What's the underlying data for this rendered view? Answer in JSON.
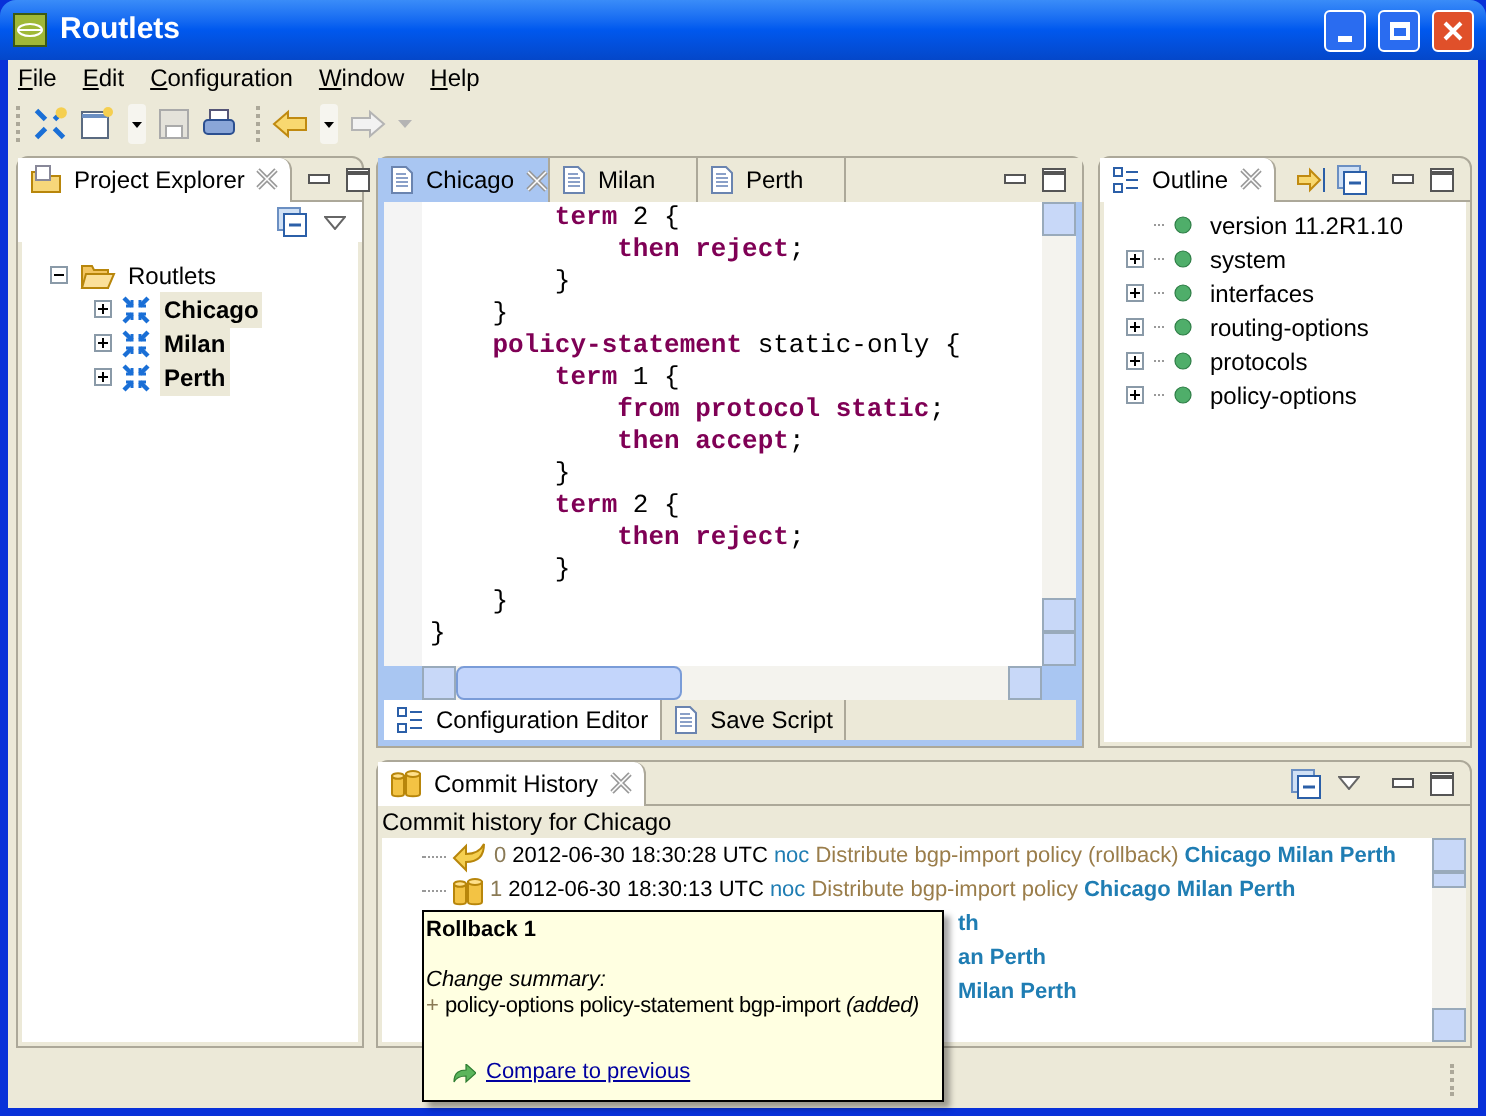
{
  "window": {
    "title": "Routlets"
  },
  "menu": [
    "File",
    "Edit",
    "Configuration",
    "Window",
    "Help"
  ],
  "project_explorer": {
    "tab": "Project Explorer",
    "root": {
      "label": "Routlets",
      "expanded": true,
      "children": [
        {
          "label": "Chicago",
          "expanded": false,
          "open": true
        },
        {
          "label": "Milan",
          "expanded": false,
          "open": true
        },
        {
          "label": "Perth",
          "expanded": false,
          "open": true
        }
      ]
    }
  },
  "editor": {
    "tabs": [
      {
        "label": "Chicago",
        "selected": true
      },
      {
        "label": "Milan",
        "selected": false
      },
      {
        "label": "Perth",
        "selected": false
      }
    ],
    "lines": [
      {
        "tokens": [
          {
            "kind": "keyword",
            "text": "        term"
          },
          {
            "kind": "plain",
            "text": " 2 {"
          }
        ]
      },
      {
        "tokens": [
          {
            "kind": "keyword",
            "text": "            then reject"
          },
          {
            "kind": "plain",
            "text": ";"
          }
        ]
      },
      {
        "tokens": [
          {
            "kind": "plain",
            "text": "        }"
          }
        ]
      },
      {
        "tokens": [
          {
            "kind": "plain",
            "text": "    }"
          }
        ]
      },
      {
        "tokens": [
          {
            "kind": "keyword",
            "text": "    policy-statement"
          },
          {
            "kind": "plain",
            "text": " static-only {"
          }
        ]
      },
      {
        "tokens": [
          {
            "kind": "keyword",
            "text": "        term"
          },
          {
            "kind": "plain",
            "text": " 1 {"
          }
        ]
      },
      {
        "tokens": [
          {
            "kind": "keyword",
            "text": "            from protocol static"
          },
          {
            "kind": "plain",
            "text": ";"
          }
        ]
      },
      {
        "tokens": [
          {
            "kind": "keyword",
            "text": "            then accept"
          },
          {
            "kind": "plain",
            "text": ";"
          }
        ]
      },
      {
        "tokens": [
          {
            "kind": "plain",
            "text": "        }"
          }
        ]
      },
      {
        "tokens": [
          {
            "kind": "keyword",
            "text": "        term"
          },
          {
            "kind": "plain",
            "text": " 2 {"
          }
        ]
      },
      {
        "tokens": [
          {
            "kind": "keyword",
            "text": "            then reject"
          },
          {
            "kind": "plain",
            "text": ";"
          }
        ]
      },
      {
        "tokens": [
          {
            "kind": "plain",
            "text": "        }"
          }
        ]
      },
      {
        "tokens": [
          {
            "kind": "plain",
            "text": "    }"
          }
        ]
      },
      {
        "tokens": [
          {
            "kind": "plain",
            "text": "}"
          }
        ]
      }
    ],
    "bottom_tabs": [
      {
        "label": "Configuration Editor",
        "selected": true
      },
      {
        "label": "Save Script",
        "selected": false
      }
    ]
  },
  "outline": {
    "tab": "Outline",
    "items": [
      {
        "label": "version 11.2R1.10",
        "kind": "leaf"
      },
      {
        "label": "system",
        "kind": "collapsed"
      },
      {
        "label": "interfaces",
        "kind": "collapsed"
      },
      {
        "label": "routing-options",
        "kind": "collapsed"
      },
      {
        "label": "protocols",
        "kind": "collapsed"
      },
      {
        "label": "policy-options",
        "kind": "collapsed"
      }
    ]
  },
  "commit_history": {
    "tab": "Commit History",
    "caption": "Commit history for Chicago",
    "rows": [
      {
        "kind": "rollback",
        "number": "0",
        "time": "2012-06-30 18:30:28 UTC",
        "user": "noc",
        "message": "Distribute bgp-import policy (rollback)",
        "routers": "Chicago Milan Perth"
      },
      {
        "kind": "commit",
        "number": "1",
        "time": "2012-06-30 18:30:13 UTC",
        "user": "noc",
        "message": "Distribute bgp-import policy",
        "routers": "Chicago Milan Perth"
      },
      {
        "kind": "partial",
        "routers": "th"
      },
      {
        "kind": "partial",
        "routers": "an Perth"
      },
      {
        "kind": "partial",
        "routers": "Milan Perth"
      }
    ]
  },
  "tooltip": {
    "title": "Rollback 1",
    "summary_label": "Change summary:",
    "changes": [
      {
        "marker": "+",
        "text": "policy-options policy-statement bgp-import *(added)*"
      }
    ],
    "link": "Compare to previous"
  }
}
